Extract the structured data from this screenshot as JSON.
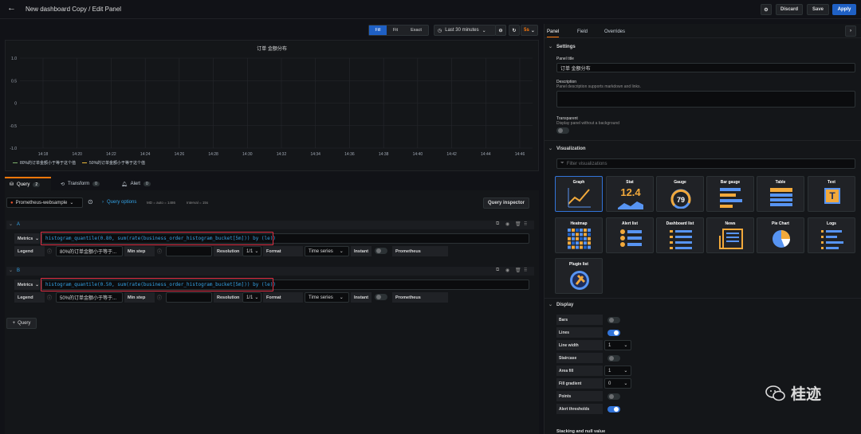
{
  "header": {
    "title": "New dashboard Copy / Edit Panel",
    "discard": "Discard",
    "save": "Save",
    "apply": "Apply"
  },
  "toolbar": {
    "fill": "Fill",
    "fit": "Fit",
    "exact": "Exact",
    "time_range": "Last 30 minutes",
    "refresh": "5s"
  },
  "chart_data": {
    "type": "line",
    "title": "订单 金额分布",
    "ylim": [
      -1.0,
      1.0
    ],
    "y_ticks": [
      "1.0",
      "0.5",
      "0",
      "-0.5",
      "-1.0"
    ],
    "x": [
      "14:18",
      "14:20",
      "14:22",
      "14:24",
      "14:26",
      "14:28",
      "14:30",
      "14:32",
      "14:34",
      "14:36",
      "14:38",
      "14:40",
      "14:42",
      "14:44",
      "14:46"
    ],
    "series": [
      {
        "name": "80%的订单金额小于等于这个值",
        "values": [],
        "color": "#7eb26d"
      },
      {
        "name": "50%的订单金额小于等于这个值",
        "values": [],
        "color": "#eab839"
      }
    ],
    "grid": true,
    "legend": "bottom-left"
  },
  "tabs": {
    "query": "Query",
    "query_count": "2",
    "transform": "Transform",
    "transform_count": "0",
    "alert": "Alert",
    "alert_count": "0"
  },
  "datasource": {
    "name": "Prometheus-websample",
    "query_options": "Query options",
    "md": "MD = auto = 1486",
    "interval": "Interval = 15s",
    "inspector": "Query inspector"
  },
  "queries": [
    {
      "letter": "A",
      "metrics_label": "Metrics",
      "expr": "histogram_quantile(0.80, sum(rate(business_order_histogram_bucket[5m])) by (le))",
      "legend_label": "Legend",
      "legend_value": "80%的订单金额小于等于...",
      "min_step_label": "Min step",
      "resolution_label": "Resolution",
      "resolution_value": "1/1",
      "format_label": "Format",
      "format_value": "Time series",
      "instant_label": "Instant",
      "prometheus_label": "Prometheus"
    },
    {
      "letter": "B",
      "metrics_label": "Metrics",
      "expr": "histogram_quantile(0.50, sum(rate(business_order_histogram_bucket[5m])) by (le))",
      "legend_label": "Legend",
      "legend_value": "50%的订单金额小于等于...",
      "min_step_label": "Min step",
      "resolution_label": "Resolution",
      "resolution_value": "1/1",
      "format_label": "Format",
      "format_value": "Time series",
      "instant_label": "Instant",
      "prometheus_label": "Prometheus"
    }
  ],
  "add_query": "Query",
  "right": {
    "tabs": [
      "Panel",
      "Field",
      "Overrides"
    ],
    "settings_title": "Settings",
    "panel_title_label": "Panel title",
    "panel_title_value": "订单 金额分布",
    "description_label": "Description",
    "description_hint": "Panel description supports markdown and links.",
    "transparent_label": "Transparent",
    "transparent_hint": "Display panel without a background",
    "visualization_title": "Visualization",
    "filter_placeholder": "Filter visualizations",
    "vis": [
      "Graph",
      "Stat",
      "Gauge",
      "Bar gauge",
      "Table",
      "Text",
      "Heatmap",
      "Alert list",
      "Dashboard list",
      "News",
      "Pie Chart",
      "Logs",
      "Plugin list"
    ],
    "stat_value": "12.4",
    "gauge_value": "79",
    "display_title": "Display",
    "display_rows": [
      {
        "label": "Bars",
        "type": "toggle",
        "on": false
      },
      {
        "label": "Lines",
        "type": "toggle",
        "on": true
      },
      {
        "label": "Line width",
        "type": "select",
        "value": "1"
      },
      {
        "label": "Staircase",
        "type": "toggle",
        "on": false
      },
      {
        "label": "Area fill",
        "type": "select",
        "value": "1"
      },
      {
        "label": "Fill gradient",
        "type": "select",
        "value": "0"
      },
      {
        "label": "Points",
        "type": "toggle",
        "on": false
      },
      {
        "label": "Alert thresholds",
        "type": "toggle",
        "on": true
      }
    ],
    "stacking_title": "Stacking and null value"
  },
  "watermark": "桂迹"
}
